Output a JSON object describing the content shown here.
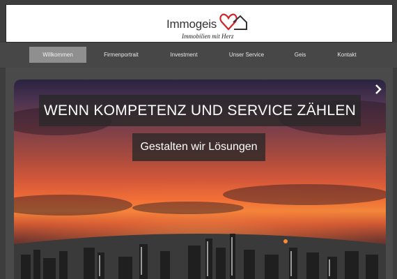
{
  "header": {
    "logo_word": "Immogeis",
    "logo_tagline": "Immobilien mit Herz",
    "logo_heart_color": "#d0232a"
  },
  "nav": {
    "items": [
      {
        "label": "Willkommen",
        "active": true
      },
      {
        "label": "Firmenportrait",
        "active": false
      },
      {
        "label": "Investment",
        "active": false
      },
      {
        "label": "Unser Service",
        "active": false
      },
      {
        "label": "Geis",
        "active": false
      },
      {
        "label": "Kontakt",
        "active": false
      }
    ]
  },
  "hero": {
    "headline": "WENN KOMPETENZ UND SERVICE ZÄHLEN",
    "subline": "Gestalten wir Lösungen",
    "next_icon": "chevron-right-icon"
  },
  "colors": {
    "page_bg": "#3d3d3d",
    "nav_bg": "#474747",
    "nav_active": "#8f8f8f",
    "caption_bg": "#2b2b2b"
  }
}
